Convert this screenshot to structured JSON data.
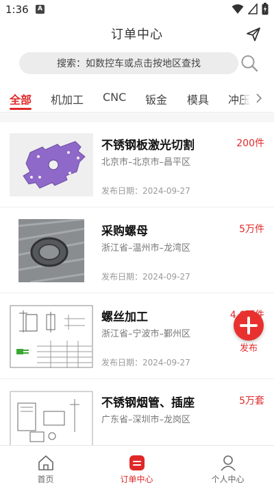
{
  "status_bar": {
    "time": "1:36",
    "notification_badge": "A"
  },
  "header": {
    "title": "订单中心"
  },
  "search": {
    "placeholder": "搜索：如数控车或点击按地区查找"
  },
  "tabs": [
    {
      "label": "全部",
      "active": true
    },
    {
      "label": "机加工",
      "active": false
    },
    {
      "label": "CNC",
      "active": false
    },
    {
      "label": "钣金",
      "active": false
    },
    {
      "label": "模具",
      "active": false
    },
    {
      "label": "冲压",
      "active": false
    }
  ],
  "orders": [
    {
      "title": "不锈钢板激光切割",
      "quantity": "200件",
      "location": "北京市–北京市–昌平区",
      "date": "发布日期：2024-09-27",
      "thumb": "purple-plate"
    },
    {
      "title": "采购螺母",
      "quantity": "5万件",
      "location": "浙江省–温州市–龙湾区",
      "date": "发布日期：2024-09-27",
      "thumb": "nut-photo"
    },
    {
      "title": "螺丝加工",
      "quantity": "4.6万件",
      "location": "浙江省–宁波市–鄞州区",
      "date": "发布日期：2024-09-27",
      "thumb": "screw-drawing"
    },
    {
      "title": "不锈钢烟管、插座",
      "quantity": "5万套",
      "location": "广东省–深圳市–龙岗区",
      "date": "",
      "thumb": "pipe-drawing"
    }
  ],
  "fab": {
    "label": "发布"
  },
  "bottom_nav": [
    {
      "label": "首页",
      "icon": "home-icon",
      "active": false
    },
    {
      "label": "订单中心",
      "icon": "order-icon",
      "active": true
    },
    {
      "label": "个人中心",
      "icon": "profile-icon",
      "active": false
    }
  ],
  "colors": {
    "accent": "#e02828",
    "fab": "#e8312f",
    "search_bg": "#ececec"
  }
}
